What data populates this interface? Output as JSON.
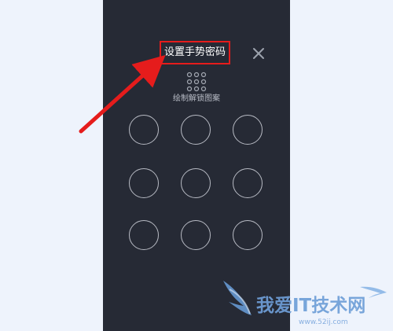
{
  "screen": {
    "title": "设置手势密码",
    "subtitle": "绘制解锁图案",
    "close_icon": "close-icon",
    "pattern_icon": "dots-grid-icon"
  },
  "pattern": {
    "nodes": [
      "",
      "",
      "",
      "",
      "",
      "",
      "",
      "",
      ""
    ]
  },
  "annotation": {
    "arrow_color": "#e51c1c",
    "highlight_color": "#e51c1c"
  },
  "watermark": {
    "text": "我爱IT技术网",
    "url": "www.52ij.com"
  },
  "colors": {
    "phone_bg": "#262a35",
    "page_bg": "#eef3fc",
    "node_stroke": "#b7bac3"
  }
}
